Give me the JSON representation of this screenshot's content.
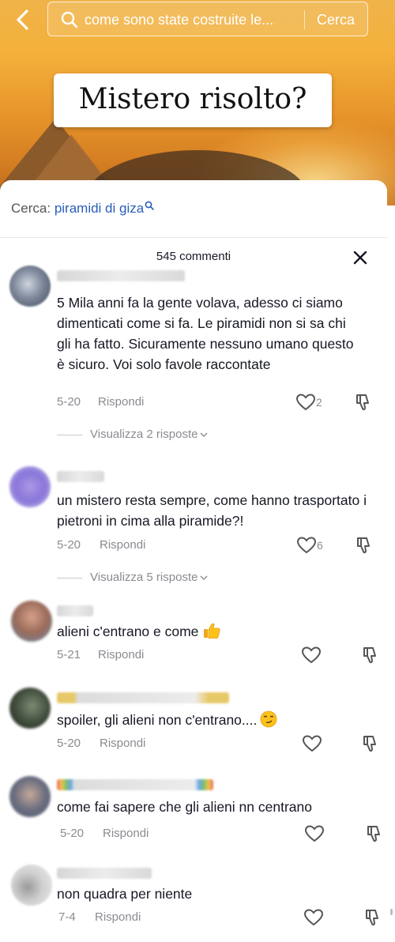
{
  "header": {
    "search_query": "come sono state costruite le...",
    "search_button": "Cerca",
    "title_card": "Mistero risolto?"
  },
  "suggestion": {
    "prefix": "Cerca:",
    "keyword": "piramidi di giza"
  },
  "comments_count": "545 commenti",
  "comments": [
    {
      "text": "5 Mila anni fa la gente volava, adesso ci siamo dimenticati come si fa. Le piramidi non si sa chi gli ha fatto. Sicuramente nessuno umano questo è sicuro. Voi solo favole raccontate",
      "date": "5-20",
      "reply": "Rispondi",
      "likes": "2",
      "view_replies": "Visualizza 2 risposte"
    },
    {
      "text": "un mistero resta sempre, come hanno trasportato i pietroni in cima alla piramide?!",
      "date": "5-20",
      "reply": "Rispondi",
      "likes": "6",
      "view_replies": "Visualizza 5 risposte"
    },
    {
      "text": "alieni c'entrano e come",
      "emoji": "thumbs-up",
      "date": "5-21",
      "reply": "Rispondi",
      "likes": ""
    },
    {
      "text": "spoiler, gli alieni non c'entrano....",
      "emoji": "smirking-face",
      "date": "5-20",
      "reply": "Rispondi",
      "likes": ""
    },
    {
      "text": "come fai sapere che gli alieni nn centrano",
      "date": "5-20",
      "reply": "Rispondi",
      "likes": ""
    },
    {
      "text": "non quadra per niente",
      "date": "7-4",
      "reply": "Rispondi",
      "likes": ""
    }
  ],
  "colors": {
    "link": "#2b5db8",
    "muted": "#8a8b91",
    "text": "#161823"
  }
}
